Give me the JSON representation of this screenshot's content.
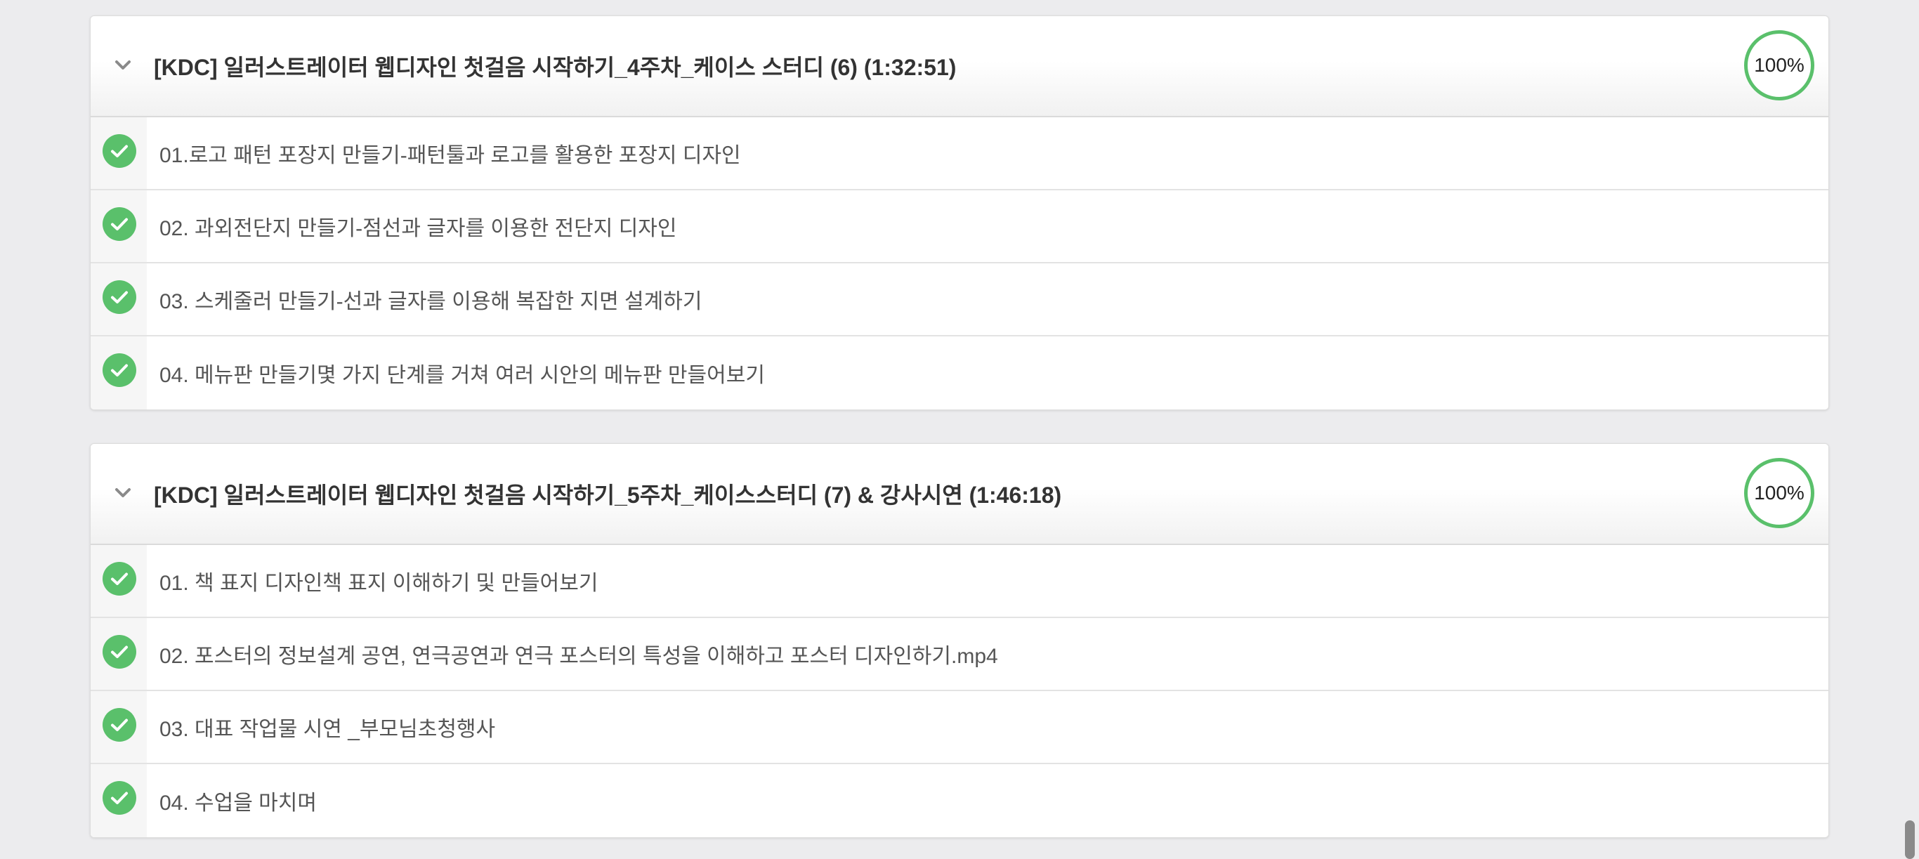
{
  "sections": [
    {
      "title": "[KDC] 일러스트레이터 웹디자인 첫걸음 시작하기_4주차_케이스 스터디 (6) (1:32:51)",
      "progress": "100%",
      "lessons": [
        {
          "label": "01.로고 패턴 포장지 만들기-패턴툴과 로고를 활용한 포장지 디자인",
          "completed": true
        },
        {
          "label": "02. 과외전단지 만들기-점선과 글자를 이용한 전단지 디자인",
          "completed": true
        },
        {
          "label": "03. 스케줄러 만들기-선과 글자를 이용해 복잡한 지면 설계하기",
          "completed": true
        },
        {
          "label": "04. 메뉴판 만들기몇 가지 단계를 거쳐 여러 시안의 메뉴판 만들어보기",
          "completed": true
        }
      ]
    },
    {
      "title": "[KDC] 일러스트레이터 웹디자인 첫걸음 시작하기_5주차_케이스스터디 (7) & 강사시연 (1:46:18)",
      "progress": "100%",
      "lessons": [
        {
          "label": "01. 책 표지 디자인책 표지 이해하기 및 만들어보기",
          "completed": true
        },
        {
          "label": "02. 포스터의 정보설계 공연, 연극공연과 연극 포스터의 특성을 이해하고 포스터 디자인하기.mp4",
          "completed": true
        },
        {
          "label": "03. 대표 작업물 시연 _부모님초청행사",
          "completed": true
        },
        {
          "label": "04. 수업을 마치며",
          "completed": true
        }
      ]
    }
  ],
  "icons": {
    "collapse": "chevron-down-icon",
    "completed": "check-circle-icon"
  },
  "colors": {
    "accent_green": "#5ac06b",
    "background": "#ececee",
    "title_text": "#333333",
    "lesson_text": "#555555"
  }
}
